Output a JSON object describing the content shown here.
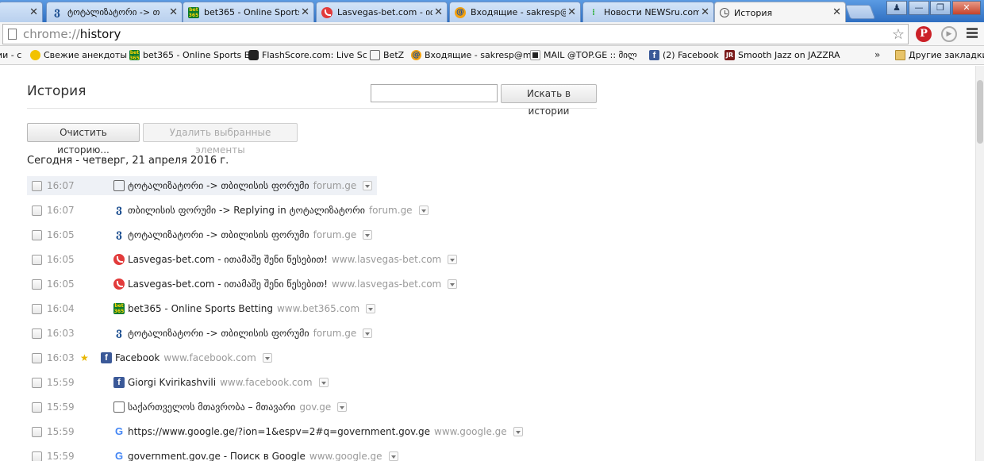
{
  "tabs": [
    {
      "title": "ტოტალიზატორი -> თ",
      "icon": "tsb-icon"
    },
    {
      "title": "bet365 - Online Sports B",
      "icon": "bet365-icon"
    },
    {
      "title": "Lasvegas-bet.com - ით",
      "icon": "lasvegas-icon"
    },
    {
      "title": "Входящие - sakresp@m",
      "icon": "mail-icon"
    },
    {
      "title": "Новости NEWSru.com",
      "icon": "newsru-icon"
    },
    {
      "title": "История",
      "icon": "history-icon"
    }
  ],
  "tab_close_glyph": "✕",
  "window": {
    "minimize": "—",
    "restore": "❐",
    "close": "✕",
    "user": "♟"
  },
  "omnibox": {
    "scheme": "chrome://",
    "host": "history"
  },
  "toolbar": {
    "star": "☆",
    "pinterest": "P",
    "play": "▶"
  },
  "bookmarks": [
    {
      "label": "ии - с",
      "icon": "page-icon"
    },
    {
      "label": "Свежие анекдоты",
      "icon": "smiley-icon"
    },
    {
      "label": "bet365 - Online Sports B",
      "icon": "bet365-icon"
    },
    {
      "label": "FlashScore.com: Live Sc",
      "icon": "flashscore-icon"
    },
    {
      "label": "BetZ",
      "icon": "page-icon"
    },
    {
      "label": "Входящие - sakresp@m",
      "icon": "mail-icon"
    },
    {
      "label": "MAIL @TOP.GE :: მილ",
      "icon": "topge-icon"
    },
    {
      "label": "(2) Facebook",
      "icon": "facebook-icon"
    },
    {
      "label": "Smooth Jazz on JAZZRA",
      "icon": "jazzradio-icon"
    }
  ],
  "bookmarks_more": "»",
  "other_bookmarks": "Другие закладки",
  "history": {
    "title": "История",
    "search_button": "Искать в истории",
    "search_value": "",
    "clear_button": "Очистить историю...",
    "delete_button": "Удалить выбранные элементы",
    "day_header": "Сегодня - четверг, 21 апреля 2016 г.",
    "entries": [
      {
        "time": "16:07",
        "title": "ტოტალიზატორი -> თბილისის ფორუმი",
        "domain": "forum.ge",
        "icon": "page-icon",
        "starred": false
      },
      {
        "time": "16:07",
        "title": "თბილისის ფორუმი -> Replying in ტოტალიზატორი",
        "domain": "forum.ge",
        "icon": "tsb-icon",
        "starred": false
      },
      {
        "time": "16:05",
        "title": "ტოტალიზატორი -> თბილისის ფორუმი",
        "domain": "forum.ge",
        "icon": "tsb-icon",
        "starred": false
      },
      {
        "time": "16:05",
        "title": "Lasvegas-bet.com - ითამაშე შენი წესებით!",
        "domain": "www.lasvegas-bet.com",
        "icon": "lasvegas-icon",
        "starred": false
      },
      {
        "time": "16:05",
        "title": "Lasvegas-bet.com - ითამაშე შენი წესებით!",
        "domain": "www.lasvegas-bet.com",
        "icon": "lasvegas-icon",
        "starred": false
      },
      {
        "time": "16:04",
        "title": "bet365 - Online Sports Betting",
        "domain": "www.bet365.com",
        "icon": "bet365-icon",
        "starred": false
      },
      {
        "time": "16:03",
        "title": "ტოტალიზატორი -> თბილისის ფორუმი",
        "domain": "forum.ge",
        "icon": "tsb-icon",
        "starred": false
      },
      {
        "time": "16:03",
        "title": "Facebook",
        "domain": "www.facebook.com",
        "icon": "facebook-icon",
        "starred": true
      },
      {
        "time": "15:59",
        "title": "Giorgi Kvirikashvili",
        "domain": "www.facebook.com",
        "icon": "facebook-icon",
        "starred": false
      },
      {
        "time": "15:59",
        "title": "საქართველოს მთავრობა – მთავარი",
        "domain": "gov.ge",
        "icon": "page-icon",
        "starred": false
      },
      {
        "time": "15:59",
        "title": "https://www.google.ge/?ion=1&espv=2#q=government.gov.ge",
        "domain": "www.google.ge",
        "icon": "google-icon",
        "starred": false
      },
      {
        "time": "15:59",
        "title": "government.gov.ge - Поиск в Google",
        "domain": "www.google.ge",
        "icon": "google-icon",
        "starred": false
      }
    ]
  }
}
